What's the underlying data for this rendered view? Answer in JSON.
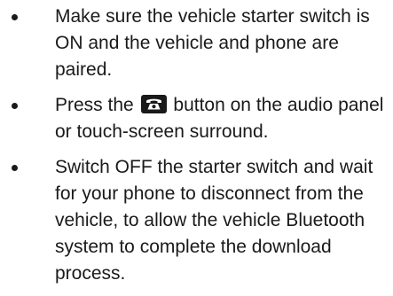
{
  "instructions": {
    "items": [
      {
        "text": "Make sure the vehicle starter switch is ON and the vehicle and phone are paired."
      },
      {
        "text_before": "Press the",
        "icon": "phone-icon",
        "text_after": "button on the audio panel or touch-screen surround."
      },
      {
        "text": "Switch OFF the starter switch and wait for your phone to disconnect from the vehicle, to allow the vehicle Bluetooth system to complete the download process."
      }
    ]
  }
}
